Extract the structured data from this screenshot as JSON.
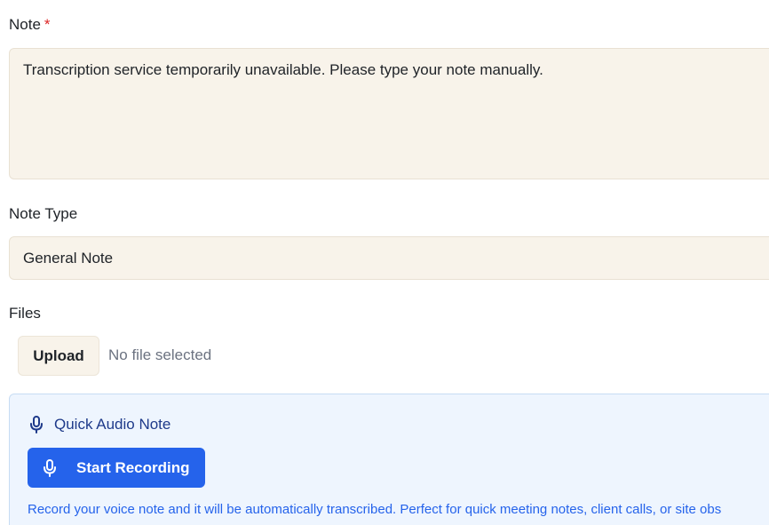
{
  "note": {
    "label": "Note",
    "required_marker": "*",
    "value": "Transcription service temporarily unavailable. Please type your note manually."
  },
  "note_type": {
    "label": "Note Type",
    "selected": "General Note"
  },
  "files": {
    "label": "Files",
    "upload_label": "Upload",
    "status": "No file selected"
  },
  "audio": {
    "title": "Quick Audio Note",
    "record_label": "Start Recording",
    "help_text": "Record your voice note and it will be automatically transcribed. Perfect for quick meeting notes, client calls, or site obs",
    "icon": "microphone-icon"
  },
  "colors": {
    "field_background": "#f8f3ea",
    "accent": "#2563eb",
    "required": "#dc2626",
    "panel_background": "#eef5fe"
  }
}
